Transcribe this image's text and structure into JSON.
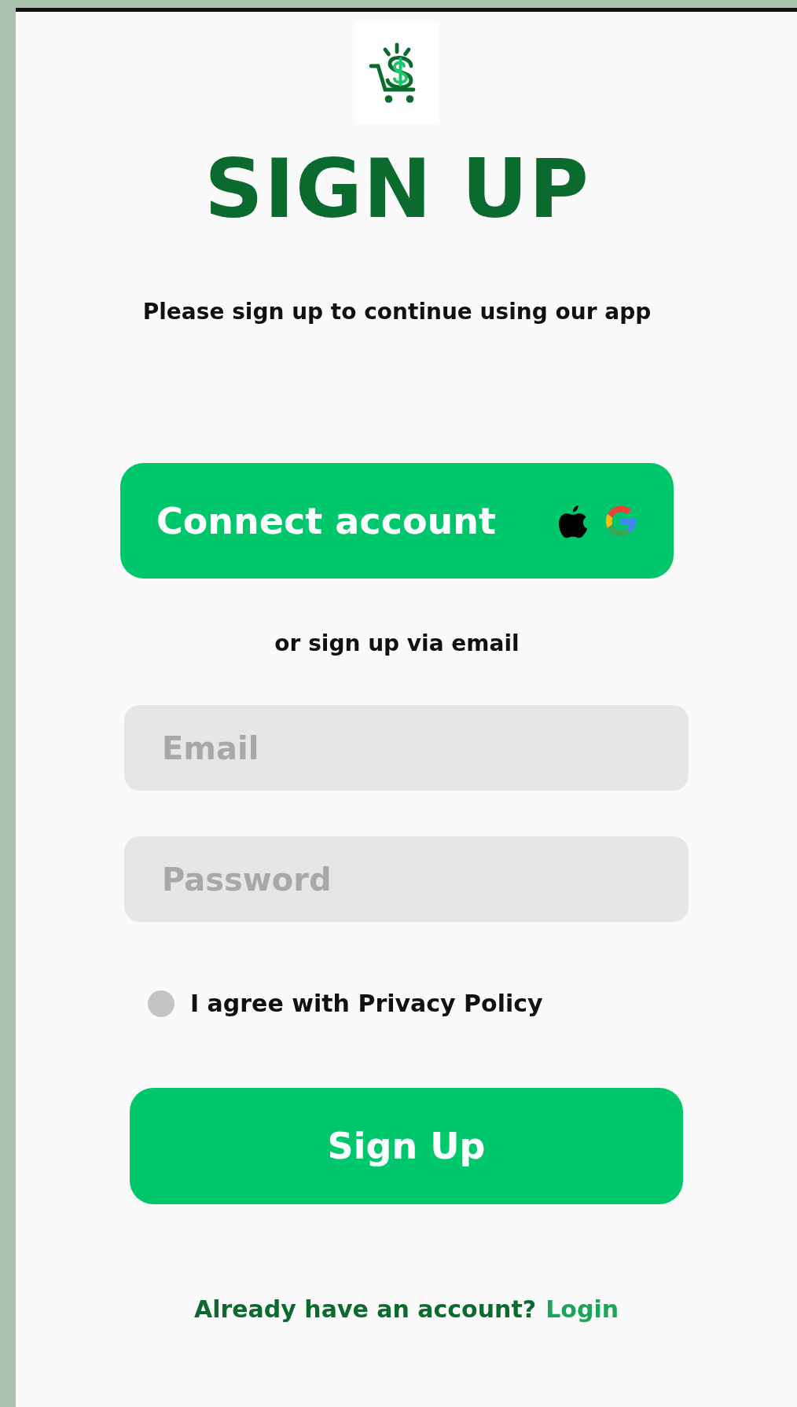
{
  "title": "SIGN UP",
  "subtitle": "Please sign up to continue using our app",
  "connect_button": {
    "label": "Connect account"
  },
  "divider_text": "or sign up via email",
  "fields": [
    {
      "placeholder": "Email"
    },
    {
      "placeholder": "Password"
    }
  ],
  "agree": {
    "label": "I agree with Privacy Policy",
    "checked": false
  },
  "signup_button": {
    "label": "Sign Up"
  },
  "footer": {
    "text": "Already have an account?",
    "link": "Login"
  }
}
